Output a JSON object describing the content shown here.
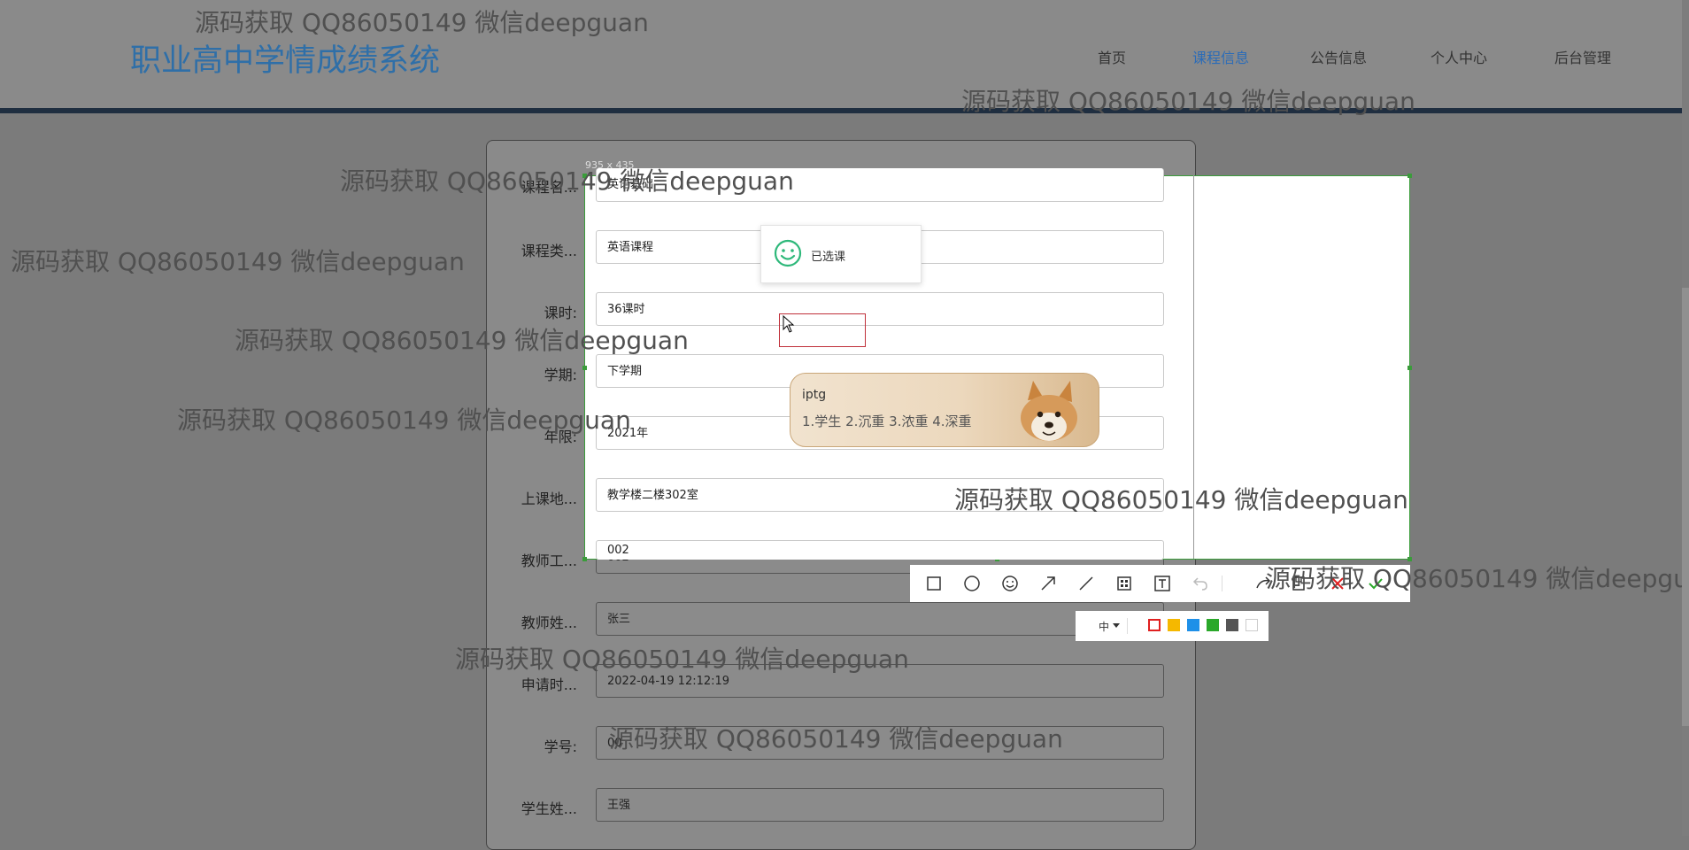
{
  "header": {
    "site_title": "职业高中学情成绩系统",
    "nav": [
      "首页",
      "课程信息",
      "公告信息",
      "个人中心",
      "后台管理"
    ],
    "active_nav": "课程信息"
  },
  "form": {
    "fields": [
      {
        "label": "课程名...",
        "value": "英语基础"
      },
      {
        "label": "课程类...",
        "value": "英语课程"
      },
      {
        "label": "课时:",
        "value": "36课时"
      },
      {
        "label": "学期:",
        "value": "下学期"
      },
      {
        "label": "年限:",
        "value": "2021年"
      },
      {
        "label": "上课地...",
        "value": "教学楼二楼302室"
      },
      {
        "label": "教师工...",
        "value": "002"
      },
      {
        "label": "教师姓...",
        "value": "张三"
      },
      {
        "label": "申请时...",
        "value": "2022-04-19 12:12:19"
      },
      {
        "label": "学号:",
        "value": "00"
      },
      {
        "label": "学生姓...",
        "value": "王强"
      }
    ]
  },
  "toast": {
    "message": "已选课",
    "icon": "smile-icon"
  },
  "screenshot_tool": {
    "size_label": "935 x 435",
    "tools": [
      "rectangle-icon",
      "ellipse-icon",
      "emoji-icon",
      "arrow-icon",
      "line-icon",
      "mosaic-icon",
      "text-icon",
      "undo-icon",
      "pin-icon",
      "save-icon",
      "cancel-icon",
      "confirm-icon"
    ],
    "font_size": "中",
    "colors": [
      "#e02020",
      "#f5b800",
      "#1e90e8",
      "#2aa82a",
      "#555555",
      "#ffffff"
    ]
  },
  "ime": {
    "input": "iptg",
    "candidates": "1.学生  2.沉重  3.浓重  4.深重"
  },
  "watermark": "源码获取 QQ86050149 微信deepguan"
}
